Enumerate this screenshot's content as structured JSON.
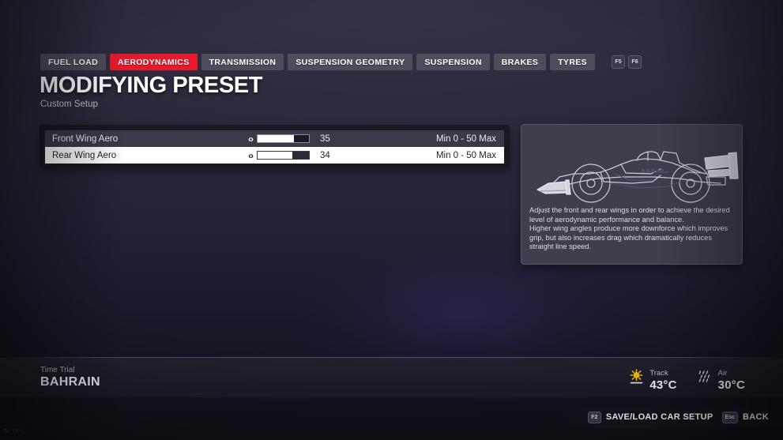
{
  "tabs": [
    {
      "label": "FUEL LOAD",
      "active": false
    },
    {
      "label": "AERODYNAMICS",
      "active": true
    },
    {
      "label": "TRANSMISSION",
      "active": false
    },
    {
      "label": "SUSPENSION GEOMETRY",
      "active": false
    },
    {
      "label": "SUSPENSION",
      "active": false
    },
    {
      "label": "BRAKES",
      "active": false
    },
    {
      "label": "TYRES",
      "active": false
    }
  ],
  "tab_keys": [
    "F5",
    "F6"
  ],
  "header": {
    "title": "MODIFYING PRESET",
    "subtitle": "Custom Setup"
  },
  "settings": [
    {
      "label": "Front Wing Aero",
      "value": "35",
      "value_num": 35,
      "min": 0,
      "max": 50,
      "range_text": "Min 0 - 50 Max",
      "selected": false,
      "arrows": "‹›"
    },
    {
      "label": "Rear Wing Aero",
      "value": "34",
      "value_num": 34,
      "min": 0,
      "max": 50,
      "range_text": "Min 0 - 50 Max",
      "selected": true,
      "arrows": "‹›"
    }
  ],
  "info": {
    "illustration": "f1-car-side-view-wireframe",
    "paragraph1": "Adjust the front and rear wings in order to achieve the desired level of aerodynamic performance and balance.",
    "paragraph2": "Higher wing angles produce more downforce which improves grip, but also increases drag which dramatically reduces straight line speed."
  },
  "status": {
    "mode": "Time Trial",
    "track": "BAHRAIN",
    "weather": [
      {
        "icon": "sun-icon",
        "label": "Track",
        "value": "43°C"
      },
      {
        "icon": "drizzle-icon",
        "label": "Air",
        "value": "30°C"
      }
    ]
  },
  "actions": [
    {
      "key": "F2",
      "label": "SAVE/LOAD CAR SETUP"
    },
    {
      "key": "Esc",
      "label": "BACK"
    }
  ],
  "fps": "66 FPS",
  "colors": {
    "accent": "#e8192c",
    "tab_bg": "#4e4d5c",
    "panel_bg": "#3f3e4d",
    "selected_row": "#ffffff"
  }
}
